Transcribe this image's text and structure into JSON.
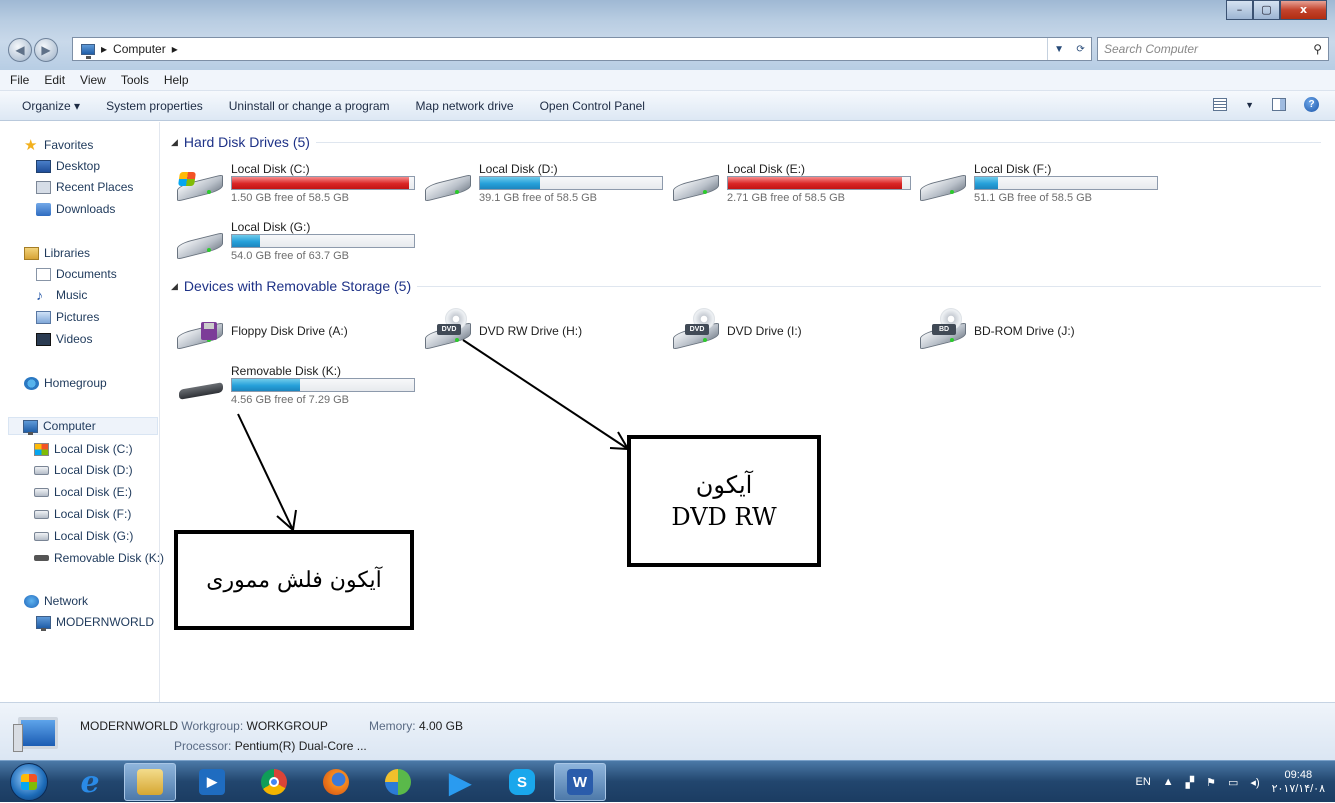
{
  "window": {
    "title_buttons": [
      "–",
      "▢",
      "x"
    ]
  },
  "address_bar": {
    "crumbs": [
      "Computer"
    ],
    "search_placeholder": "Search Computer"
  },
  "menu": [
    "File",
    "Edit",
    "View",
    "Tools",
    "Help"
  ],
  "toolbar": [
    "Organize ▾",
    "System properties",
    "Uninstall or change a program",
    "Map network drive",
    "Open Control Panel"
  ],
  "sidebar": {
    "favorites": {
      "title": "Favorites",
      "items": [
        "Desktop",
        "Recent Places",
        "Downloads"
      ]
    },
    "libraries": {
      "title": "Libraries",
      "items": [
        "Documents",
        "Music",
        "Pictures",
        "Videos"
      ]
    },
    "homegroup": "Homegroup",
    "computer": {
      "title": "Computer",
      "items": [
        "Local Disk (C:)",
        "Local Disk (D:)",
        "Local Disk (E:)",
        "Local Disk (F:)",
        "Local Disk (G:)",
        "Removable Disk (K:)"
      ]
    },
    "network": {
      "title": "Network",
      "items": [
        "MODERNWORLD"
      ]
    }
  },
  "groups": {
    "hdd": "Hard Disk Drives (5)",
    "removable": "Devices with Removable Storage (5)"
  },
  "drives": [
    {
      "name": "Local Disk (C:)",
      "free": "1.50 GB free of 58.5 GB",
      "used_fraction": 0.974,
      "status": "full"
    },
    {
      "name": "Local Disk (D:)",
      "free": "39.1 GB free of 58.5 GB",
      "used_fraction": 0.33,
      "status": "ok"
    },
    {
      "name": "Local Disk (E:)",
      "free": "2.71 GB free of 58.5 GB",
      "used_fraction": 0.954,
      "status": "full"
    },
    {
      "name": "Local Disk (F:)",
      "free": "51.1 GB free of 58.5 GB",
      "used_fraction": 0.126,
      "status": "ok"
    },
    {
      "name": "Local Disk (G:)",
      "free": "54.0 GB free of 63.7 GB",
      "used_fraction": 0.152,
      "status": "ok"
    }
  ],
  "devices": [
    {
      "name": "Floppy Disk Drive (A:)",
      "icon": "floppy-icon"
    },
    {
      "name": "DVD RW Drive (H:)",
      "icon": "dvd-rw-icon",
      "tag": "DVD"
    },
    {
      "name": "DVD Drive (I:)",
      "icon": "dvd-icon",
      "tag": "DVD"
    },
    {
      "name": "BD-ROM Drive (J:)",
      "icon": "bd-rom-icon",
      "tag": "BD"
    },
    {
      "name": "Removable Disk (K:)",
      "free": "4.56 GB free of 7.29 GB",
      "used_fraction": 0.374,
      "icon": "usb-drive-icon"
    }
  ],
  "annotations": {
    "flash": "آیکون فلش مموری",
    "dvd_line1": "آیکون",
    "dvd_line2": "DVD RW"
  },
  "details": {
    "name": "MODERNWORLD",
    "workgroup_label": "Workgroup:",
    "workgroup": "WORKGROUP",
    "memory_label": "Memory:",
    "memory": "4.00 GB",
    "processor_label": "Processor:",
    "processor": "Pentium(R) Dual-Core ..."
  },
  "taskbar": {
    "lang": "EN",
    "time": "09:48",
    "date": "۲۰۱۷/۱۴/۰۸"
  },
  "colors": {
    "bar_ok": "#26a0da",
    "bar_full": "#da2626",
    "group_header": "#1e3287"
  }
}
